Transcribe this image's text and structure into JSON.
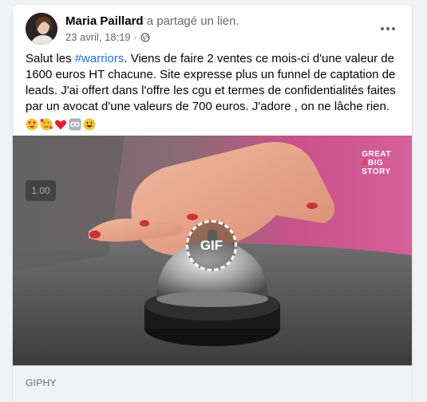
{
  "post": {
    "author": "Maria Paillard",
    "action": "a partagé un lien.",
    "timestamp": "23 avril, 18:19",
    "separator": "·",
    "privacy_icon": "globe-icon",
    "more_icon": "more-options-icon",
    "text_prefix": "Salut les ",
    "hashtag": "#warriors",
    "text_rest": ". Viens de faire 2 ventes ce mois-ci d'une valeur de 1600 euros HT chacune. Site expresse plus un funnel de captation de leads. J'ai offert dans l'offre les cgu et termes de confidentialités faites par un avocat d'une valeurs de 700 euros. J'adore , on ne lâche rien.",
    "emojis": [
      "heart-eyes-emoji",
      "smiling-face-with-hearts-emoji",
      "red-heart-emoji",
      "infinity-emoji",
      "grinning-face-emoji"
    ]
  },
  "media": {
    "speed_label": "1.00",
    "gif_label": "GIF",
    "watermark": [
      "GREAT",
      "BIG",
      "STORY"
    ],
    "watermark_accent": "&",
    "colors": {
      "background_pink": "#d7548f",
      "hand": "#e9a48c",
      "nail_polish": "#c8323a",
      "bell_chrome": "#b9b9b9",
      "bell_base": "#1a1a1a"
    }
  },
  "link": {
    "source": "GIPHY"
  },
  "colors": {
    "page_bg": "#f0f2f5",
    "hashtag": "#216fdb",
    "secondary_text": "#65676b"
  }
}
